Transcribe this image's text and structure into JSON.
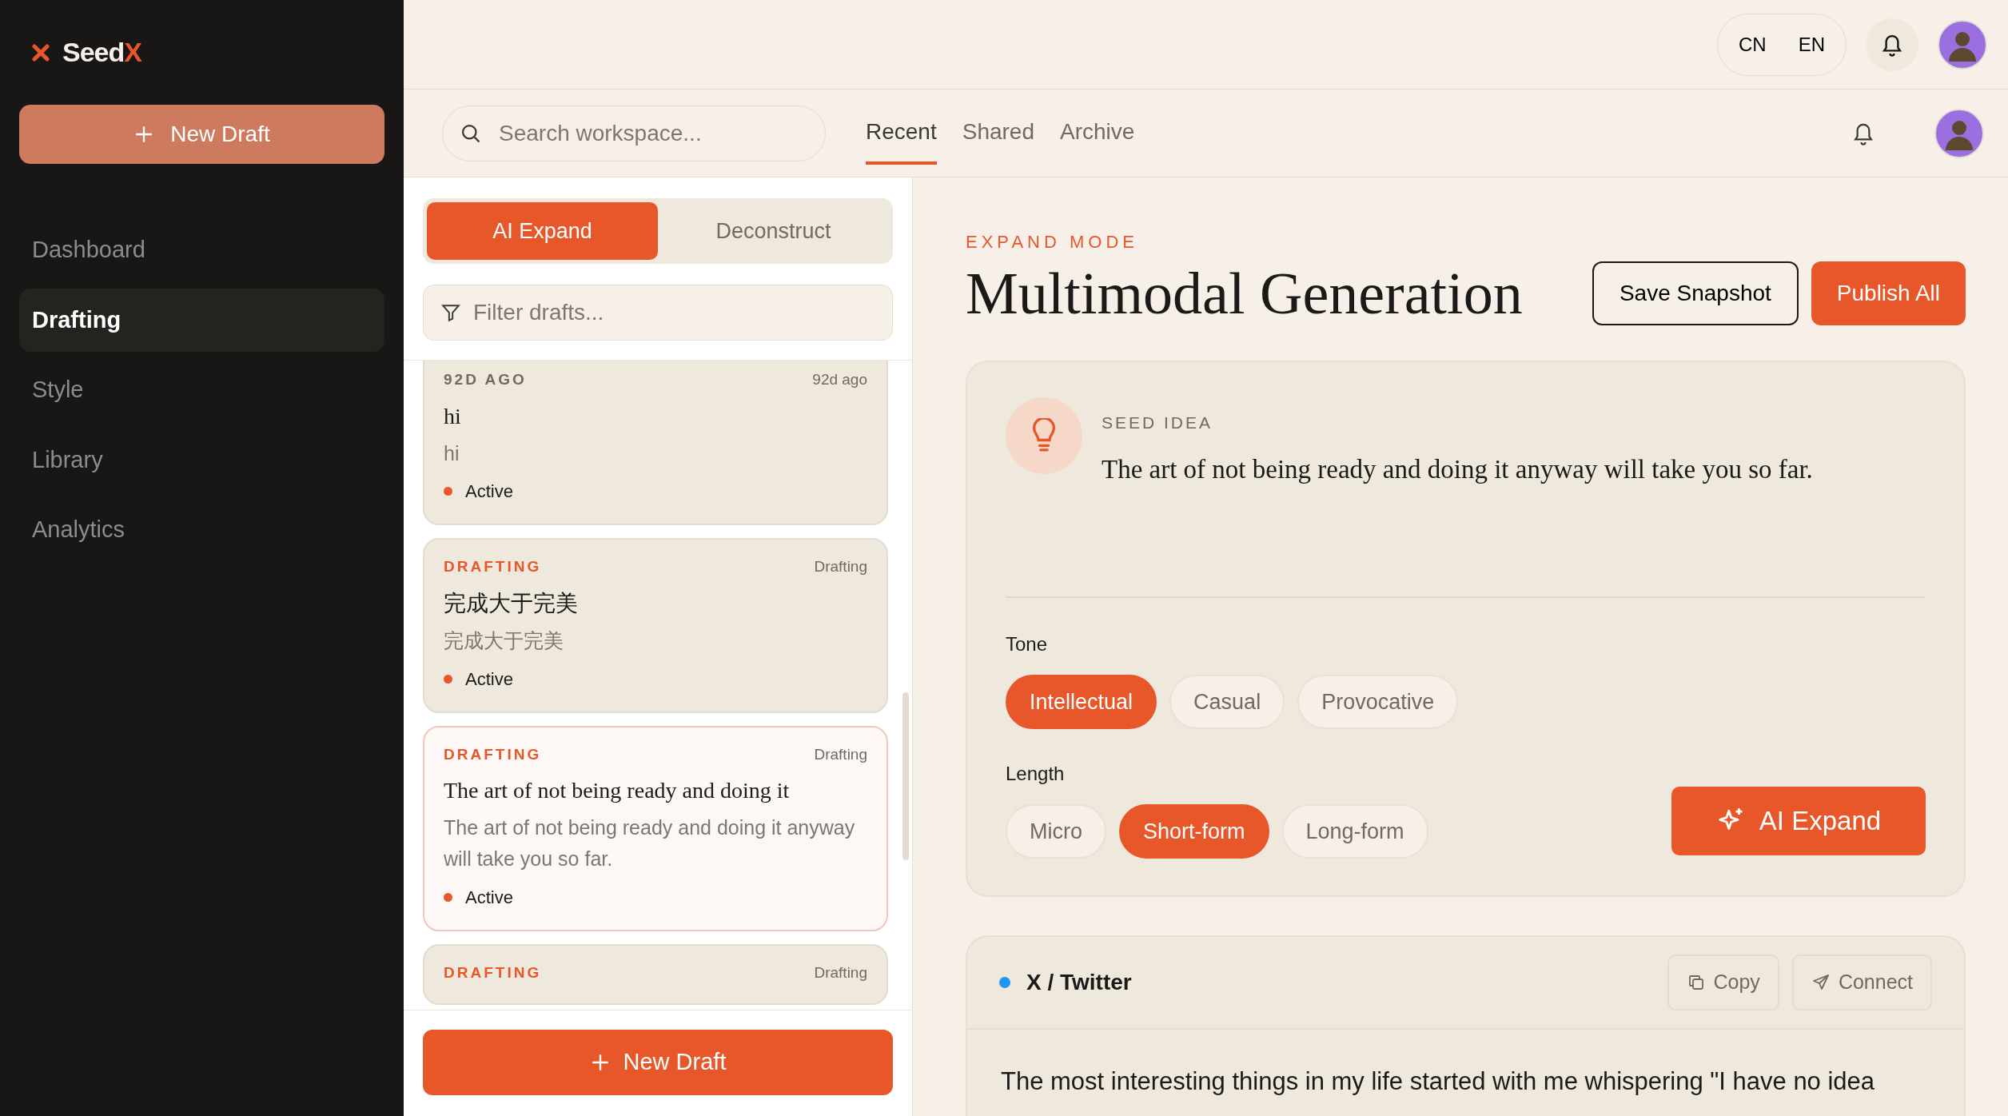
{
  "sidebar": {
    "logo": "SeedX",
    "new_draft": "New Draft",
    "items": [
      {
        "label": "Dashboard",
        "selected": false
      },
      {
        "label": "Drafting",
        "selected": true
      },
      {
        "label": "Style",
        "selected": false
      },
      {
        "label": "Library",
        "selected": false
      },
      {
        "label": "Analytics",
        "selected": false
      }
    ]
  },
  "topbar": {
    "languages": [
      "CN",
      "EN"
    ]
  },
  "header": {
    "search": {
      "placeholder": "Search workspace..."
    },
    "tabs": [
      {
        "label": "Recent",
        "selected": true
      },
      {
        "label": "Shared",
        "selected": false
      },
      {
        "label": "Archive",
        "selected": false
      }
    ]
  },
  "panel": {
    "modes": [
      {
        "label": "AI Expand",
        "selected": true
      },
      {
        "label": "Deconstruct",
        "selected": false
      }
    ],
    "filter": {
      "placeholder": "Filter drafts..."
    },
    "drafts": [
      {
        "tag": "92D AGO",
        "kind": "age",
        "time": "92d ago",
        "title": "hi",
        "body": "hi",
        "status": "Active",
        "selected": false
      },
      {
        "tag": "DRAFTING",
        "kind": "status",
        "time": "Drafting",
        "title": "完成大于完美",
        "body": "完成大于完美",
        "status": "Active",
        "selected": false
      },
      {
        "tag": "DRAFTING",
        "kind": "status",
        "time": "Drafting",
        "title": "The art of not being ready and doing it",
        "body": "The art of not being ready and doing it anyway will take you so far.",
        "status": "Active",
        "selected": true
      },
      {
        "tag": "DRAFTING",
        "kind": "status",
        "time": "Drafting",
        "selected": false
      }
    ],
    "new_draft": "New Draft"
  },
  "main": {
    "eyebrow": "EXPAND MODE",
    "title": "Multimodal Generation",
    "save": "Save Snapshot",
    "publish": "Publish All",
    "seed": {
      "label": "SEED IDEA",
      "text": "The art of not being ready and doing it anyway will take you so far."
    },
    "groups": [
      {
        "label": "Tone",
        "options": [
          {
            "label": "Intellectual",
            "selected": true
          },
          {
            "label": "Casual",
            "selected": false
          },
          {
            "label": "Provocative",
            "selected": false
          }
        ]
      },
      {
        "label": "Length",
        "options": [
          {
            "label": "Micro",
            "selected": false
          },
          {
            "label": "Short-form",
            "selected": true
          },
          {
            "label": "Long-form",
            "selected": false
          }
        ]
      }
    ],
    "expand": "AI Expand",
    "output": {
      "platform": "X / Twitter",
      "color": "#2196f3",
      "copy": "Copy",
      "connect": "Connect",
      "text": "The most interesting things in my life started with me whispering \"I have no idea"
    }
  }
}
